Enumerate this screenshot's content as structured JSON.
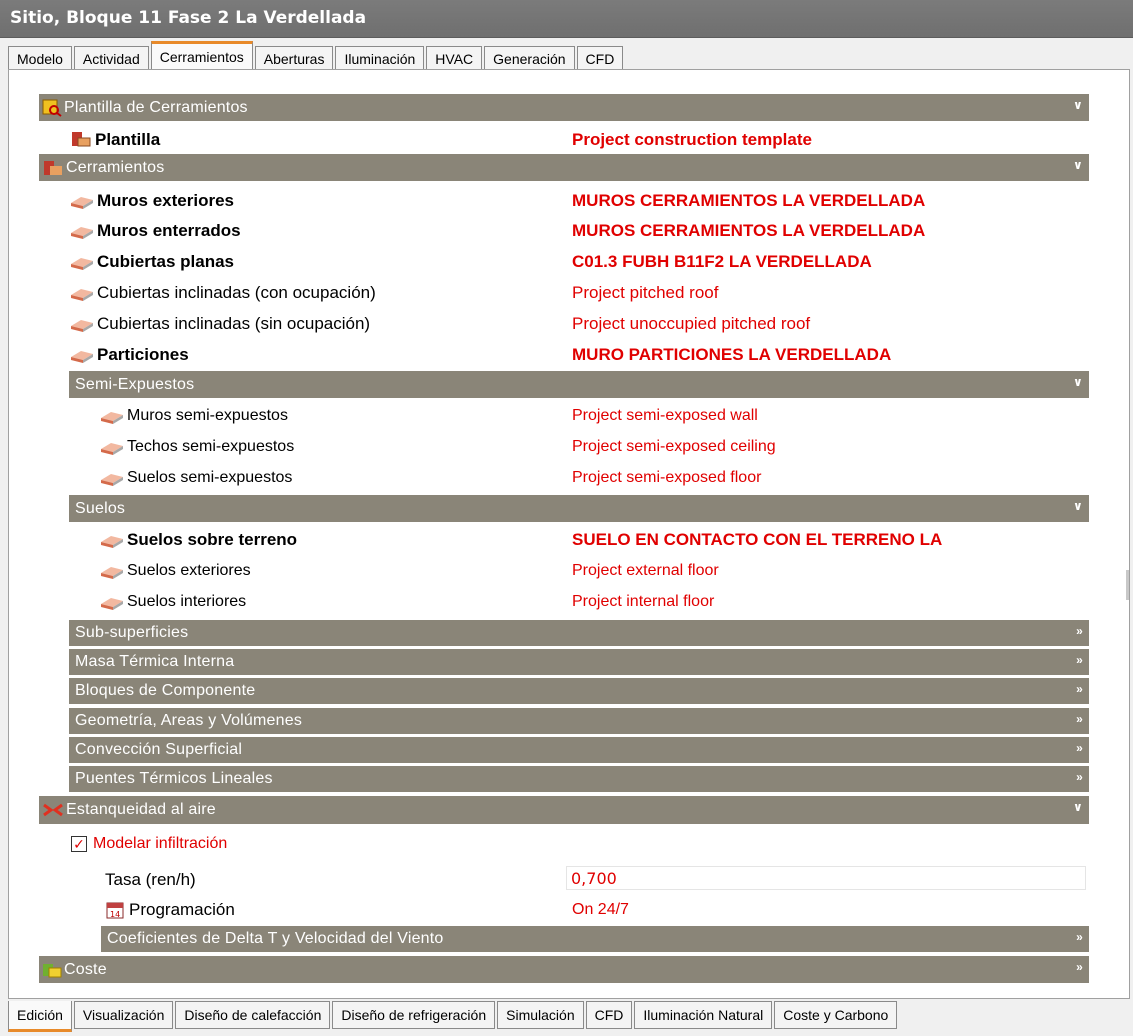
{
  "window": {
    "title": "Sitio, Bloque 11 Fase 2 La Verdellada"
  },
  "top_tabs": [
    "Modelo",
    "Actividad",
    "Cerramientos",
    "Aberturas",
    "Iluminación",
    "HVAC",
    "Generación",
    "CFD"
  ],
  "top_tabs_active": "Cerramientos",
  "sections": {
    "plantilla_header": "Plantilla de Cerramientos",
    "plantilla_label": "Plantilla",
    "plantilla_value": "Project construction template",
    "cerramientos_header": "Cerramientos",
    "muros_exteriores": {
      "label": "Muros exteriores",
      "value": "MUROS CERRAMIENTOS LA VERDELLADA"
    },
    "muros_enterrados": {
      "label": "Muros enterrados",
      "value": "MUROS CERRAMIENTOS LA VERDELLADA"
    },
    "cubiertas_planas": {
      "label": "Cubiertas planas",
      "value": "C01.3 FUBH B11F2 LA VERDELLADA"
    },
    "cubiertas_incl_con": {
      "label": "Cubiertas inclinadas (con ocupación)",
      "value": "Project pitched roof"
    },
    "cubiertas_incl_sin": {
      "label": "Cubiertas inclinadas (sin ocupación)",
      "value": "Project unoccupied pitched roof"
    },
    "particiones": {
      "label": "Particiones",
      "value": "MURO PARTICIONES LA VERDELLADA"
    },
    "semi_header": "Semi-Expuestos",
    "muros_semi": {
      "label": "Muros semi-expuestos",
      "value": "Project semi-exposed wall"
    },
    "techos_semi": {
      "label": "Techos semi-expuestos",
      "value": "Project semi-exposed ceiling"
    },
    "suelos_semi": {
      "label": "Suelos semi-expuestos",
      "value": "Project semi-exposed floor"
    },
    "suelos_header": "Suelos",
    "suelos_terreno": {
      "label": "Suelos sobre terreno",
      "value": "SUELO EN CONTACTO CON EL TERRENO LA"
    },
    "suelos_ext": {
      "label": "Suelos exteriores",
      "value": "Project external floor"
    },
    "suelos_int": {
      "label": "Suelos interiores",
      "value": "Project internal floor"
    },
    "sub_superficies": "Sub-superficies",
    "masa_termica": "Masa Térmica Interna",
    "bloques": "Bloques de Componente",
    "geometria": "Geometría, Areas y Volúmenes",
    "conveccion": "Convección Superficial",
    "puentes": "Puentes Térmicos Lineales",
    "estanqueidad_header": "Estanqueidad al aire",
    "modelar_infiltracion": "Modelar infiltración",
    "tasa_label": "Tasa (ren/h)",
    "tasa_value": "0,700",
    "programacion_label": "Programación",
    "programacion_value": "On 24/7",
    "coeficientes": "Coeficientes de Delta T y Velocidad del Viento",
    "coste": "Coste"
  },
  "bottom_tabs": [
    "Edición",
    "Visualización",
    "Diseño de calefacción",
    "Diseño de refrigeración",
    "Simulación",
    "CFD",
    "Iluminación Natural",
    "Coste y Carbono"
  ],
  "bottom_tabs_active": "Edición",
  "colors": {
    "accent": "#e88a2a",
    "value_red": "#e00000",
    "header_bg": "#8a8578"
  }
}
